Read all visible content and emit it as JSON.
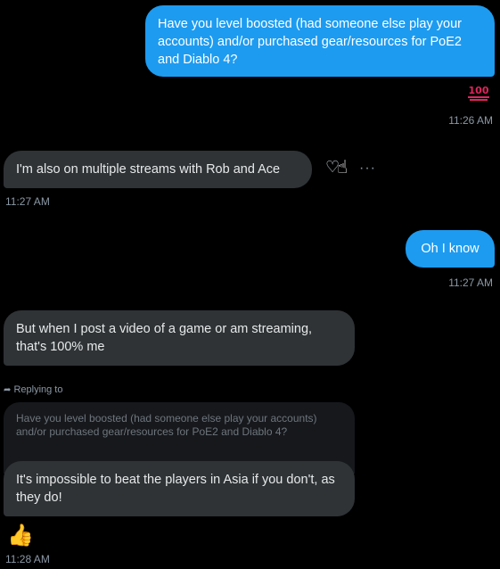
{
  "messages": {
    "m1": {
      "text": "Have you level boosted (had someone else play your accounts) and/or purchased gear/resources for PoE2 and Diablo 4?",
      "reaction": "100",
      "time": "11:26 AM"
    },
    "m2": {
      "text": "I'm also on multiple streams with Rob and Ace",
      "time": "11:27 AM"
    },
    "m3": {
      "text": "Oh I know",
      "time": "11:27 AM"
    },
    "m4": {
      "text": "But when I post a video of a game or am streaming, that's 100% me"
    },
    "m5": {
      "replying_label": "Replying to",
      "quoted_text": "Have you level boosted (had someone else play your accounts) and/or purchased gear/resources for PoE2 and Diablo 4?",
      "text": "It's impossible to beat the players in Asia if you don't, as they do!",
      "reaction": "👍",
      "time": "11:28 AM"
    }
  },
  "icons": {
    "react": "heart-add-icon",
    "more": "more-dots-icon",
    "reply": "reply-arrow-icon"
  },
  "colors": {
    "background": "#000000",
    "sent_bubble": "#1d9bf0",
    "received_bubble": "#2f3336",
    "quoted_bubble": "#16181c",
    "timestamp": "#8b98a5"
  }
}
